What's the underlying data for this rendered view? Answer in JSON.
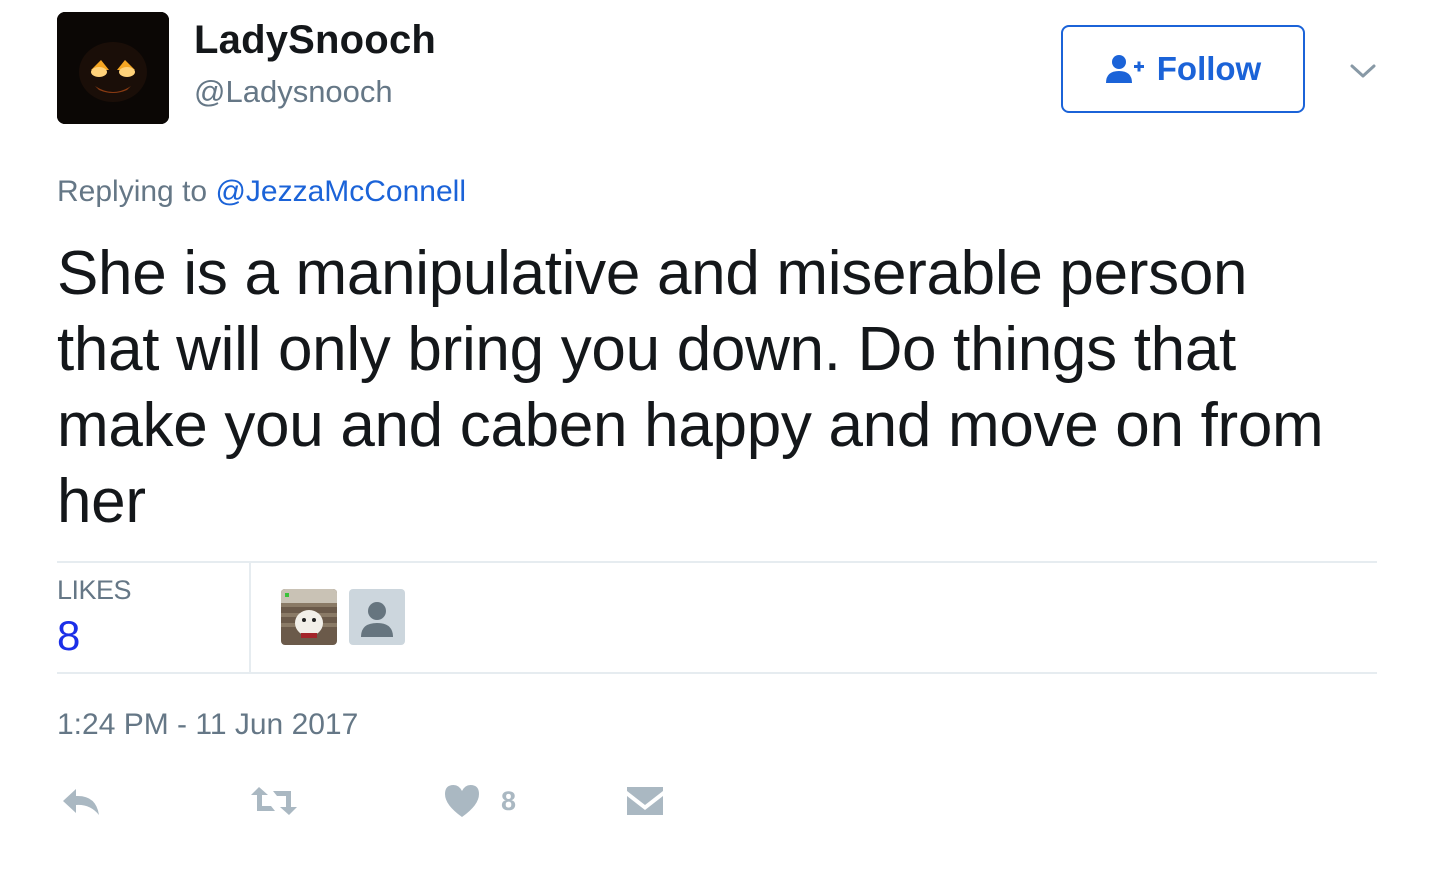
{
  "author": {
    "display_name": "LadySnooch",
    "screen_name": "@Ladysnooch",
    "avatar_icon": "jack-o-lantern-avatar"
  },
  "follow_button": {
    "label": "Follow",
    "icon": "add-user-icon",
    "color": "#1b63d8"
  },
  "menu": {
    "icon": "chevron-down-icon"
  },
  "reply_context": {
    "prefix": "Replying to",
    "handle": "@JezzaMcConnell"
  },
  "tweet": {
    "lines": [
      "She is a manipulative and miserable person",
      "that will only bring you down. Do things that",
      "make you and caben happy and move on from",
      "her"
    ]
  },
  "stats": {
    "likes_label": "LIKES",
    "likes_count": "8",
    "likers": [
      {
        "icon": "dog-photo-avatar"
      },
      {
        "icon": "default-user-avatar"
      }
    ]
  },
  "timestamp": "1:24 PM - 11 Jun 2017",
  "actions": {
    "reply_icon": "reply-icon",
    "retweet_icon": "retweet-icon",
    "like_icon": "heart-icon",
    "like_count": "8",
    "dm_icon": "envelope-icon"
  },
  "colors": {
    "link": "#1b63d8",
    "secondary_text": "#657786",
    "action_gray": "#aab8c2",
    "likes_count": "#1b2fe8"
  }
}
